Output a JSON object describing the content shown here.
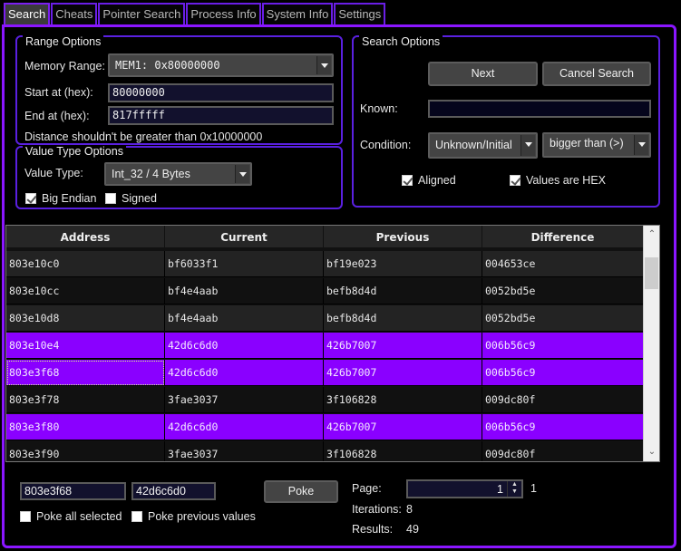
{
  "tabs": [
    {
      "label": "Search",
      "active": true
    },
    {
      "label": "Cheats",
      "active": false
    },
    {
      "label": "Pointer Search",
      "active": false
    },
    {
      "label": "Process Info",
      "active": false
    },
    {
      "label": "System Info",
      "active": false
    },
    {
      "label": "Settings",
      "active": false
    }
  ],
  "range_options": {
    "title": "Range Options",
    "memory_range_label": "Memory Range:",
    "memory_range_value": "MEM1: 0x80000000",
    "start_label": "Start at (hex):",
    "start_value": "80000000",
    "end_label": "End at (hex):",
    "end_value": "817fffff",
    "note": "Distance shouldn't be greater than 0x10000000"
  },
  "value_type_options": {
    "title": "Value Type Options",
    "value_type_label": "Value Type:",
    "value_type_value": "Int_32 / 4 Bytes",
    "big_endian_label": "Big Endian",
    "big_endian_checked": true,
    "signed_label": "Signed",
    "signed_checked": false
  },
  "search_options": {
    "title": "Search Options",
    "next_label": "Next",
    "cancel_label": "Cancel Search",
    "known_label": "Known:",
    "known_value": "",
    "condition_label": "Condition:",
    "condition_value": "Unknown/Initial",
    "comparison_value": "bigger than (>)",
    "aligned_label": "Aligned",
    "aligned_checked": true,
    "hex_label": "Values are HEX",
    "hex_checked": true
  },
  "results_table": {
    "columns": [
      "Address",
      "Current",
      "Previous",
      "Difference"
    ],
    "rows": [
      {
        "address": "803e10c0",
        "current": "bf6033f1",
        "previous": "bf19e023",
        "difference": "004653ce",
        "selected": false
      },
      {
        "address": "803e10cc",
        "current": "bf4e4aab",
        "previous": "befb8d4d",
        "difference": "0052bd5e",
        "selected": false
      },
      {
        "address": "803e10d8",
        "current": "bf4e4aab",
        "previous": "befb8d4d",
        "difference": "0052bd5e",
        "selected": false
      },
      {
        "address": "803e10e4",
        "current": "42d6c6d0",
        "previous": "426b7007",
        "difference": "006b56c9",
        "selected": true
      },
      {
        "address": "803e3f68",
        "current": "42d6c6d0",
        "previous": "426b7007",
        "difference": "006b56c9",
        "selected": true
      },
      {
        "address": "803e3f78",
        "current": "3fae3037",
        "previous": "3f106828",
        "difference": "009dc80f",
        "selected": false
      },
      {
        "address": "803e3f80",
        "current": "42d6c6d0",
        "previous": "426b7007",
        "difference": "006b56c9",
        "selected": true
      },
      {
        "address": "803e3f90",
        "current": "3fae3037",
        "previous": "3f106828",
        "difference": "009dc80f",
        "selected": false
      }
    ]
  },
  "poke": {
    "address_value": "803e3f68",
    "value_value": "42d6c6d0",
    "poke_label": "Poke",
    "poke_all_label": "Poke all selected",
    "poke_all_checked": false,
    "poke_prev_label": "Poke previous values",
    "poke_prev_checked": false
  },
  "status": {
    "page_label": "Page:",
    "page_value": "1",
    "page_total": "1",
    "iterations_label": "Iterations:",
    "iterations_value": "8",
    "results_label": "Results:",
    "results_value": "49"
  },
  "colors": {
    "accent": "#8a16ff",
    "selection": "#8a00ff",
    "input_bg": "#12112d"
  }
}
